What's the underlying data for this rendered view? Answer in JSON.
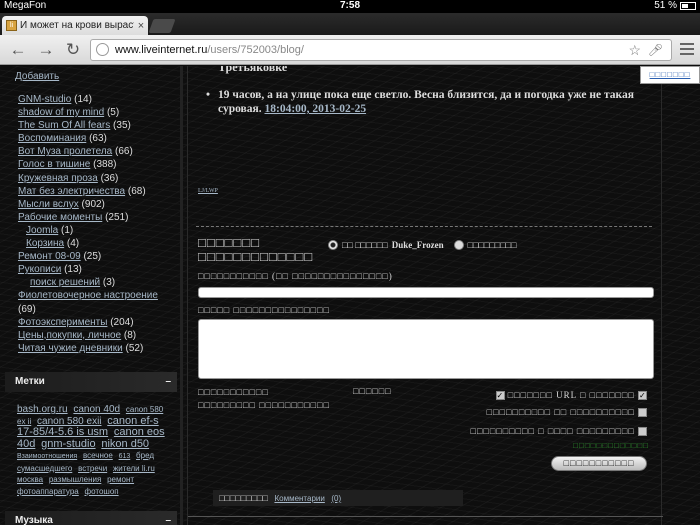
{
  "status_bar": {
    "carrier": "MegaFon",
    "time": "7:58",
    "battery": "51 %",
    "battery_level": 0.51
  },
  "tabs": [
    {
      "title": "И может на крови вырасти",
      "close": "×"
    }
  ],
  "toolbar": {
    "back_icon": "back-arrow-icon",
    "forward_icon": "forward-arrow-icon",
    "reload_icon": "reload-icon",
    "url_domain": "www.liveinternet.ru",
    "url_path": "/users/752003/blog/"
  },
  "sidebar": {
    "add_link": "Добавить",
    "categories": [
      {
        "label": "GNM-studio",
        "count": "(14)",
        "level": 1
      },
      {
        "label": "shadow of my mind",
        "count": "(5)",
        "level": 1
      },
      {
        "label": "The Sum Of All fears",
        "count": "(35)",
        "level": 1
      },
      {
        "label": "Воспоминания",
        "count": "(63)",
        "level": 1
      },
      {
        "label": "Вот Муза пролетела",
        "count": "(66)",
        "level": 1
      },
      {
        "label": "Голос в тишине",
        "count": "(388)",
        "level": 1
      },
      {
        "label": "Кружевная проза",
        "count": "(36)",
        "level": 1
      },
      {
        "label": "Мат без электричества",
        "count": "(68)",
        "level": 1
      },
      {
        "label": "Мысли вслух",
        "count": "(902)",
        "level": 1
      },
      {
        "label": "Рабочие моменты",
        "count": "(251)",
        "level": 1
      },
      {
        "label": "Joomla",
        "count": "(1)",
        "level": 2
      },
      {
        "label": "Корзина",
        "count": "(4)",
        "level": 2
      },
      {
        "label": "Ремонт 08-09",
        "count": "(25)",
        "level": 1
      },
      {
        "label": "Рукописи",
        "count": "(13)",
        "level": 1
      },
      {
        "label": "поиск решений",
        "count": "(3)",
        "level": 3
      },
      {
        "label": "Фиолетовочерное настроение",
        "count": "",
        "level": 1
      },
      {
        "label": "",
        "count": "(69)",
        "level": 1
      },
      {
        "label": "Фотоэксперименты",
        "count": "(204)",
        "level": 1
      },
      {
        "label": "Цены,покупки, личное",
        "count": "(8)",
        "level": 1
      },
      {
        "label": "Читая чужие дневники",
        "count": "(52)",
        "level": 1
      }
    ],
    "tags_header": "Метки",
    "tags_toggle": "–",
    "tags": [
      {
        "text": "bash.org.ru",
        "size": 3
      },
      {
        "text": "canon 40d",
        "size": 3
      },
      {
        "text": "canon 580 ex ii",
        "size": 2
      },
      {
        "text": "canon 580 exii",
        "size": 3
      },
      {
        "text": "canon ef-s 17-85/4-5.6 is usm",
        "size": 4
      },
      {
        "text": "canon eos 40d",
        "size": 4
      },
      {
        "text": "gnm-studio",
        "size": 4
      },
      {
        "text": "nikon d50",
        "size": 4
      },
      {
        "text": "Взаимоотношения",
        "size": 1
      },
      {
        "text": "всечное",
        "size": 2
      },
      {
        "text": "613",
        "size": 1
      },
      {
        "text": "бред сумасшедшего",
        "size": 2
      },
      {
        "text": "встречи",
        "size": 2
      },
      {
        "text": "жители li.ru",
        "size": 2
      },
      {
        "text": "москва",
        "size": 2
      },
      {
        "text": "размышления",
        "size": 2
      },
      {
        "text": "ремонт",
        "size": 2
      },
      {
        "text": "фотоаппаратура",
        "size": 2
      },
      {
        "text": "фотошоп",
        "size": 2
      }
    ],
    "music_header": "Музыка",
    "music_toggle": "–"
  },
  "main": {
    "top_fragment": "Третьяковке",
    "bullet_text": "19 часов, а на улице пока еще светло. Весна близится, да и погодка уже не такая суровая.",
    "bullet_date": "18:04:00, 2013-02-25",
    "lj_link": "LJ/LWP",
    "form_title": "□□□□□□□ □□□□□□□□□□□□□",
    "radio_label_1": "□□ □□□□□□",
    "radio_user": "Duke_Frozen",
    "radio_label_2": "□□□□□□□□□",
    "title_label": "□□□□□□□□□□□ (□□ □□□□□□□□□□□□□□□)",
    "body_label": "□□□□□ □□□□□□□□□□□□□□□",
    "opt_left_1": "□□□□□□□□□□□",
    "opt_left_2": "□□□□□□□□□  □□□□□□□□□□□",
    "opt_mid": "□□□□□□",
    "opt_row_1_text": "□□□□□□□ URL □ □□□□□□□",
    "opt_row_2_text": "□□□□□□□□□□ □□ □□□□□□□□□□",
    "opt_row_3_text": "□□□□□□□□□□ □ □□□□ □□□□□□□□□",
    "captcha_text": "□□□□□□□□□□□□□",
    "submit_label": "□□□□□□□□□□□",
    "comment_bar_label": "□□□□□□□□□",
    "comments_link": "Комментарии",
    "comments_count": "(0)"
  },
  "right_box_label": "□□□□□□□"
}
